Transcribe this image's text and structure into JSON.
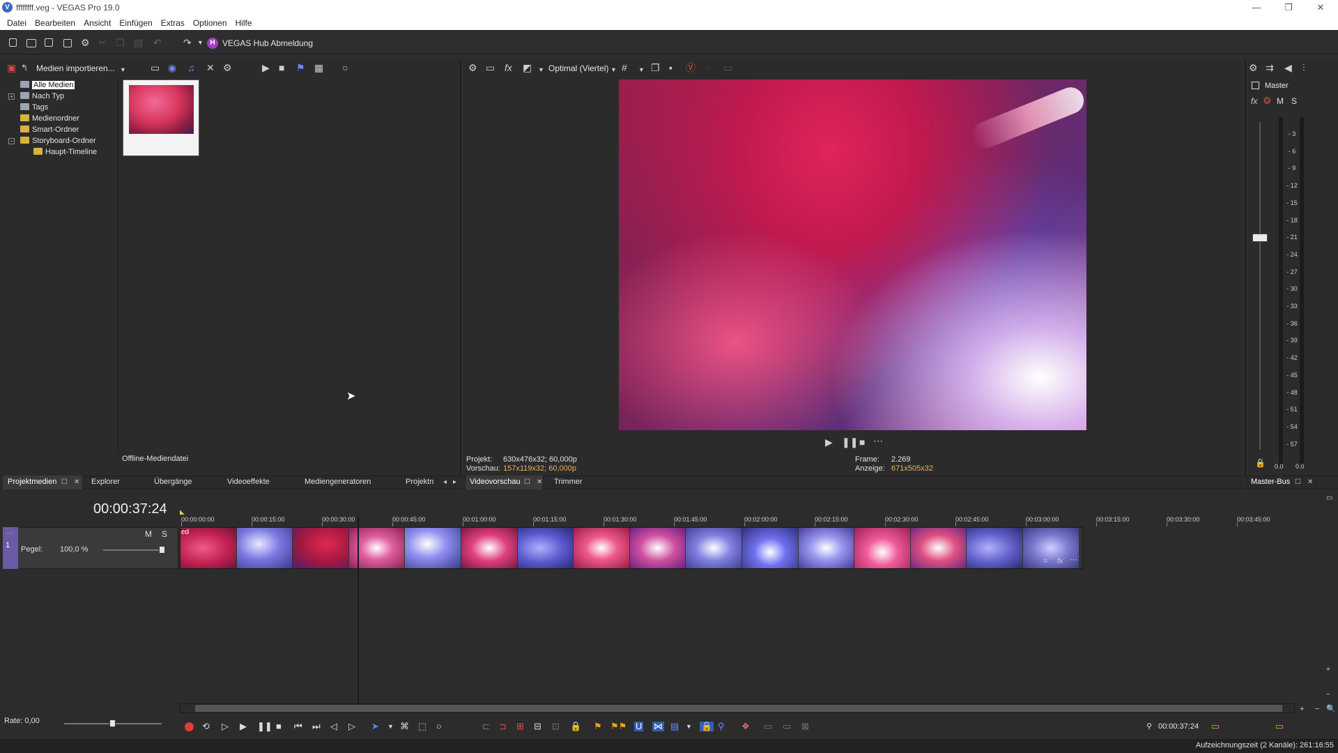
{
  "app": {
    "title": "ffffffff.veg - VEGAS Pro 19.0",
    "logo_glyph": "V",
    "accent": "#a23fbf"
  },
  "window_controls": {
    "minimize": "—",
    "restore": "❐",
    "close": "✕"
  },
  "menu": [
    "Datei",
    "Bearbeiten",
    "Ansicht",
    "Einfügen",
    "Extras",
    "Optionen",
    "Hilfe"
  ],
  "toolbar": {
    "hub_glyph": "H",
    "hub_label": "VEGAS Hub Abmeldung"
  },
  "media_panel": {
    "import_label": "Medien importieren...",
    "tree": [
      {
        "label": "Alle Medien",
        "icon": "stack-icon",
        "selected": true
      },
      {
        "label": "Nach Typ",
        "icon": "stack-icon",
        "expandable": true
      },
      {
        "label": "Tags",
        "icon": "stack-icon"
      },
      {
        "label": "Medienordner",
        "icon": "folder-icon"
      },
      {
        "label": "Smart-Ordner",
        "icon": "folder-icon"
      },
      {
        "label": "Storyboard-Ordner",
        "icon": "folder-icon",
        "expandable": true,
        "expanded": true
      },
      {
        "label": "Haupt-Timeline",
        "icon": "folder-icon",
        "child": true
      }
    ],
    "offline_label": "Offline-Mediendatei"
  },
  "preview": {
    "quality": "Optimal (Viertel)",
    "projekt_label": "Projekt:",
    "projekt_value": "630x476x32; 60,000p",
    "vorschau_label": "Vorschau:",
    "vorschau_value": "157x119x32; 60,000p",
    "frame_label": "Frame:",
    "frame_value": "2.269",
    "anzeige_label": "Anzeige:",
    "anzeige_value": "671x505x32"
  },
  "mixer": {
    "master_label": "Master",
    "m": "M",
    "s": "S",
    "db_scale": [
      "3",
      "6",
      "9",
      "12",
      "15",
      "18",
      "21",
      "24",
      "27",
      "30",
      "33",
      "36",
      "39",
      "42",
      "45",
      "48",
      "51",
      "54",
      "57"
    ],
    "left_value": "0.0",
    "right_value": "0.0"
  },
  "tabs_left": [
    "Projektmedien",
    "Explorer",
    "Übergänge",
    "Videoeffekte",
    "Mediengeneratoren",
    "Projektn"
  ],
  "tabs_middle": [
    "Videovorschau",
    "Trimmer"
  ],
  "tabs_right": [
    "Master-Bus"
  ],
  "timeline": {
    "time_display": "00:00:37:24",
    "ruler": [
      "00:00:00:00",
      "00:00:15:00",
      "00:00:30:00",
      "00:00:45:00",
      "00:01:00:00",
      "00:01:15:00",
      "00:01:30:00",
      "00:01:45:00",
      "00:02:00:00",
      "00:02:15:00",
      "00:02:30:00",
      "00:02:45:00",
      "00:03:00:00",
      "00:03:15:00",
      "00:03:30:00",
      "00:03:45:00"
    ],
    "track": {
      "number": "1",
      "m": "M",
      "s": "S",
      "level_label": "Pegel:",
      "level_value": "100,0 %"
    },
    "clip_label": "ed"
  },
  "transport": {
    "rate_label": "Rate: 0,00",
    "end_time": "00:00:37:24"
  },
  "status": {
    "text": "Aufzeichnungszeit (2 Kanäle): 261:16:55"
  }
}
